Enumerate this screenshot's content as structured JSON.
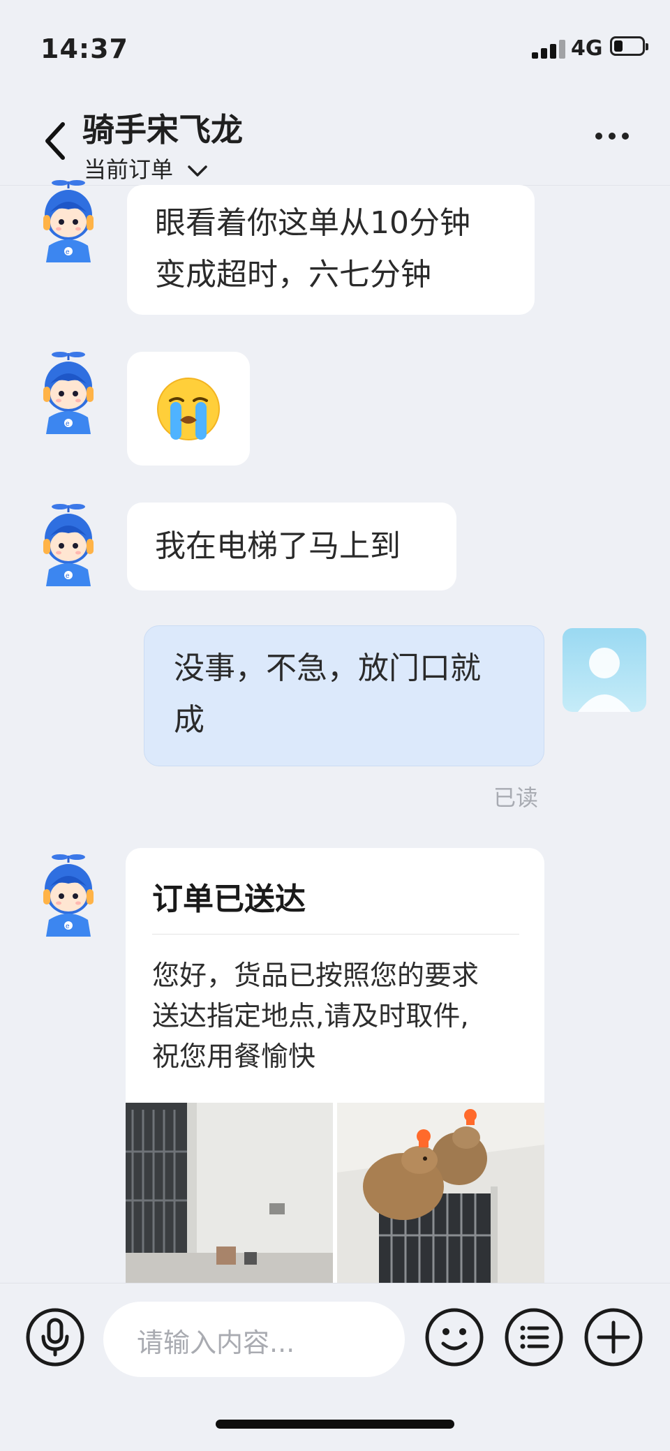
{
  "status_bar": {
    "time": "14:37",
    "network": "4G",
    "battery_level": 0.25
  },
  "header": {
    "title": "骑手宋飞龙",
    "subtitle": "当前订单",
    "back_icon": "chevron-left-icon",
    "more_icon": "more-icon"
  },
  "messages": [
    {
      "sender": "rider",
      "lines": [
        "眼看着你这单从10分钟",
        "变成超时，六七分钟"
      ]
    },
    {
      "sender": "rider",
      "emoji": "crying-face-emoji"
    },
    {
      "sender": "rider",
      "text": "我在电梯了马上到"
    },
    {
      "sender": "me",
      "lines": [
        "没事，不急，放门口就",
        "成"
      ],
      "status": "已读"
    }
  ],
  "delivery_card": {
    "title": "订单已送达",
    "lines": [
      "您好，货品已按照您的要求",
      "送达指定地点,请及时取件,",
      "祝您用餐愉快"
    ]
  },
  "input_bar": {
    "placeholder": "请输入内容...",
    "voice_icon": "microphone-icon",
    "emoji_icon": "smiley-icon",
    "menu_icon": "list-icon",
    "add_icon": "plus-icon"
  },
  "colors": {
    "background": "#eef0f5",
    "outgoing_bubble": "#dce9fb",
    "rider_avatar": "#2f6fe0"
  }
}
